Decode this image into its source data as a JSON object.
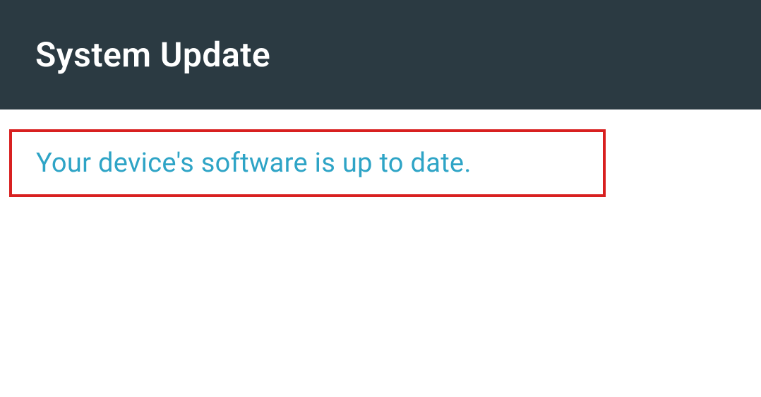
{
  "header": {
    "title": "System Update"
  },
  "status": {
    "message": "Your device's software is up to date."
  },
  "colors": {
    "header_bg": "#2b3a42",
    "accent": "#2ea4c6",
    "highlight_border": "#d82020"
  }
}
